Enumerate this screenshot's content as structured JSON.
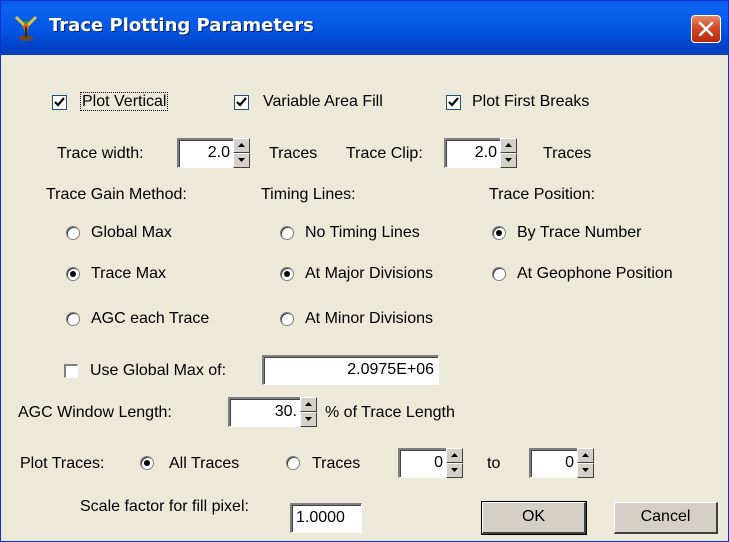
{
  "window": {
    "title": "Trace Plotting Parameters",
    "icon": "app-icon",
    "close_icon": "close-icon"
  },
  "checkboxes": {
    "plot_vertical": {
      "label": "Plot Vertical",
      "checked": true
    },
    "variable_area_fill": {
      "label": "Variable Area Fill",
      "checked": true
    },
    "plot_first_breaks": {
      "label": "Plot First Breaks",
      "checked": true
    }
  },
  "trace_width": {
    "label": "Trace width:",
    "value": "2.0",
    "unit": "Traces"
  },
  "trace_clip": {
    "label": "Trace Clip:",
    "value": "2.0",
    "unit": "Traces"
  },
  "gain_method": {
    "heading": "Trace Gain Method:",
    "options": [
      "Global Max",
      "Trace Max",
      "AGC each Trace"
    ],
    "selected": "Trace Max"
  },
  "timing_lines": {
    "heading": "Timing Lines:",
    "options": [
      "No Timing Lines",
      "At Major Divisions",
      "At Minor Divisions"
    ],
    "selected": "At Major Divisions"
  },
  "trace_position": {
    "heading": "Trace Position:",
    "options": [
      "By Trace Number",
      "At Geophone Position"
    ],
    "selected": "By Trace Number"
  },
  "global_max": {
    "label": "Use Global Max of:",
    "checked": false,
    "value": "2.0975E+06"
  },
  "agc_window": {
    "label": "AGC Window Length:",
    "value": "30.",
    "unit": "% of Trace Length"
  },
  "plot_traces": {
    "label": "Plot Traces:",
    "all_label": "All Traces",
    "range_label": "Traces",
    "selected": "All Traces",
    "from": "0",
    "to_label": "to",
    "to": "0"
  },
  "scale_factor": {
    "label": "Scale factor for fill pixel:",
    "value": "1.0000"
  },
  "buttons": {
    "ok": "OK",
    "cancel": "Cancel"
  }
}
